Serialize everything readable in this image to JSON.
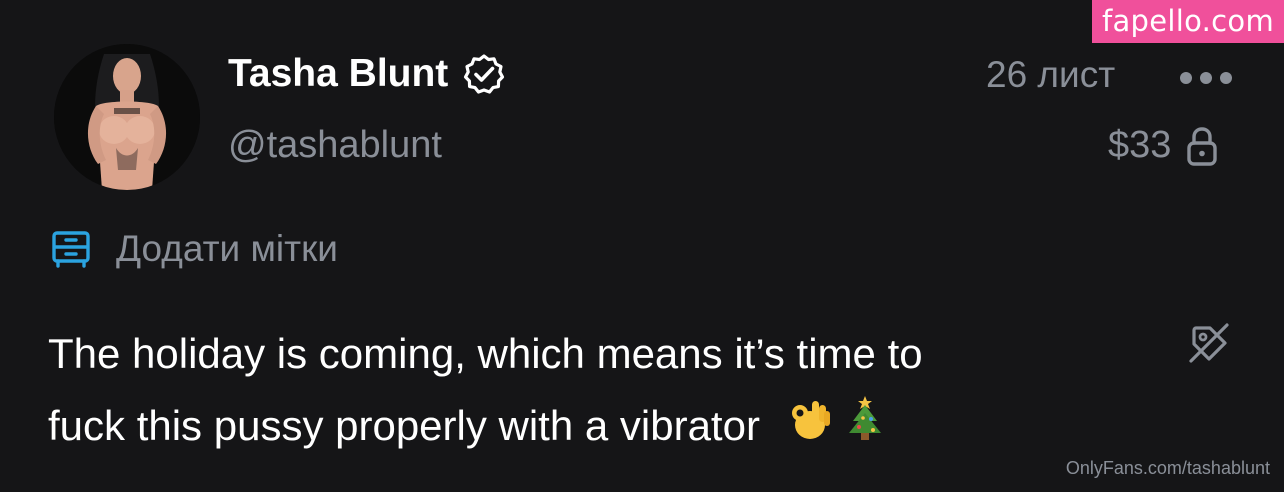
{
  "watermark": {
    "label": "fapello.com"
  },
  "post": {
    "author_name": "Tasha Blunt",
    "author_handle": "@tashablunt",
    "date": "26 лист",
    "price": "$33",
    "add_tags_label": "Додати мітки",
    "text_line1": "The holiday is coming, which means it’s time to",
    "text_line2": "fuck this pussy properly with a vibrator"
  },
  "icons": {
    "verified": "verified-badge-icon",
    "more": "more-horizontal-icon",
    "lock": "lock-icon",
    "tags": "tag-drawer-icon",
    "edit_tags": "tag-off-icon",
    "emoji_1": "ok-hand-emoji",
    "emoji_2": "christmas-tree-emoji"
  },
  "colors": {
    "background": "#151517",
    "text_primary": "#ffffff",
    "text_secondary": "#8a8f98",
    "accent": "#2ba3e0",
    "watermark": "#f0509b"
  },
  "footer": {
    "watermark_text": "OnlyFans.com/tashablunt"
  }
}
